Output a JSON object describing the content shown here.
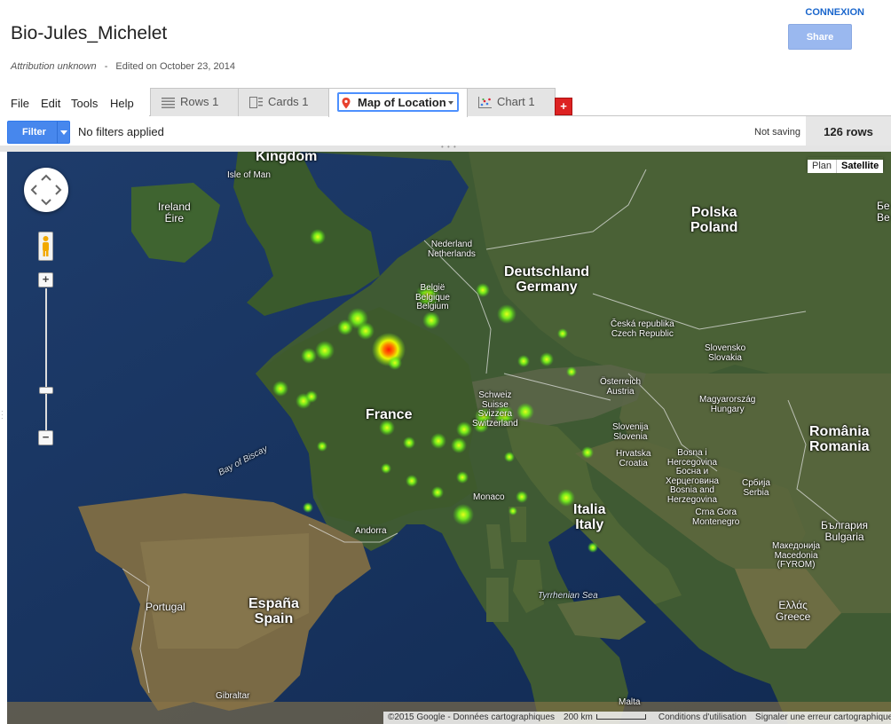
{
  "header": {
    "title": "Bio-Jules_Michelet",
    "attribution": "Attribution unknown",
    "separator": "-",
    "edited": "Edited on October 23, 2014",
    "connexion_label": "CONNEXION",
    "share_label": "Share"
  },
  "menu": {
    "file": "File",
    "edit": "Edit",
    "tools": "Tools",
    "help": "Help"
  },
  "tabs": [
    {
      "label": "Rows 1",
      "icon": "rows-icon"
    },
    {
      "label": "Cards 1",
      "icon": "cards-icon"
    },
    {
      "label": "Map of Location",
      "icon": "map-pin-icon",
      "active": true
    },
    {
      "label": "Chart 1",
      "icon": "chart-icon"
    }
  ],
  "add_tab_label": "+",
  "filterbar": {
    "filter_label": "Filter",
    "filters_text": "No filters applied",
    "saving_status": "Not saving",
    "row_count": "126 rows"
  },
  "map": {
    "type_plan": "Plan",
    "type_satellite": "Satellite",
    "zoom_in": "+",
    "zoom_out": "−",
    "labels": {
      "kingdom": "Kingdom",
      "isle_of_man": "Isle of Man",
      "ireland": "Ireland\nÉire",
      "nederland": "Nederland\nNetherlands",
      "belgie": "België\nBelgique\nBelgium",
      "deutschland": "Deutschland\nGermany",
      "polska": "Polska\nPoland",
      "be_edge": "Бе\nBe",
      "ceska": "Česká republika\nCzech Republic",
      "slovensko": "Slovensko\nSlovakia",
      "osterreich": "Österreich\nAustria",
      "magyarorszag": "Magyarország\nHungary",
      "schweiz": "Schweiz\nSuisse\nSvizzera\nSwitzerland",
      "france": "France",
      "romania": "România\nRomania",
      "slovenija": "Slovenija\nSlovenia",
      "hrvatska": "Hrvatska\nCroatia",
      "bosna": "Bosna i\nHercegovina\nБосна и\nХерцеговина\nBosnia and\nHerzegovina",
      "srbija": "Србија\nSerbia",
      "crna_gora": "Crna Gora\nMontenegro",
      "bulgaria": "България\nBulgaria",
      "macedonia": "Македонија\nMacedonia\n(FYROM)",
      "bay_of_biscay": "Bay of Biscay",
      "monaco": "Monaco",
      "italia": "Italia\nItaly",
      "andorra": "Andorra",
      "portugal": "Portugal",
      "espana": "España\nSpain",
      "tyrrhenian": "Tyrrhenian Sea",
      "greece": "Ελλάς\nGreece",
      "gibraltar": "Gibraltar",
      "malta": "Malta"
    },
    "attribution": {
      "copyright": "©2015 Google - Données cartographiques",
      "scale": "200 km",
      "terms": "Conditions d'utilisation",
      "report": "Signaler une erreur cartographique"
    },
    "heat_colors": {
      "low": "#7dff1a",
      "mid": "#f2ff00",
      "high": "#ff1a00"
    }
  }
}
